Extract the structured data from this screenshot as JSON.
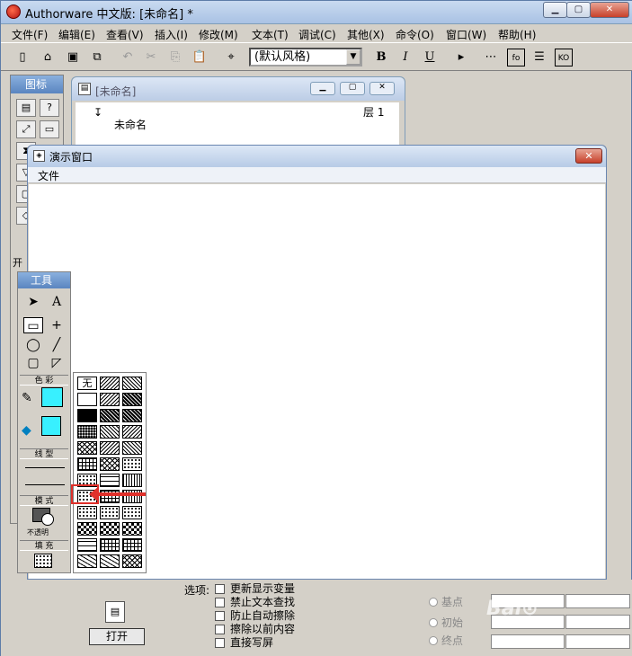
{
  "app": {
    "title": "Authorware 中文版: [未命名] *"
  },
  "window_controls": {
    "minimize": "▁",
    "maximize": "▢",
    "close": "✕"
  },
  "menu": [
    "文件(F)",
    "编辑(E)",
    "查看(V)",
    "插入(I)",
    "修改(M)",
    "文本(T)",
    "调试(C)",
    "其他(X)",
    "命令(O)",
    "窗口(W)",
    "帮助(H)"
  ],
  "toolbar": {
    "style_select": "(默认风格)",
    "bold": "B",
    "italic": "I",
    "underline": "U"
  },
  "icon_palette": {
    "title": "图标",
    "footer": "开"
  },
  "flow_window": {
    "title": "[未命名]",
    "level_label": "层 1",
    "file_name": "未命名"
  },
  "present_window": {
    "title": "演示窗口",
    "menu_file": "文件",
    "close": "✕"
  },
  "tools_panel": {
    "title": "工具",
    "color_label": "色 彩",
    "line_label": "线 型",
    "mode_label": "模 式",
    "mode_value": "不透明",
    "fill_label": "填 充",
    "text_tool": "A"
  },
  "pattern_panel": {
    "none_label": "无"
  },
  "options": {
    "label": "选项:",
    "items": [
      "更新显示变量",
      "禁止文本查找",
      "防止自动擦除",
      "擦除以前内容",
      "直接写屏"
    ]
  },
  "radios": [
    "基点",
    "初始",
    "终点"
  ],
  "open_button": "打开",
  "colors": {
    "accent": "#e0302a",
    "fill_color": "#38f0ff"
  }
}
